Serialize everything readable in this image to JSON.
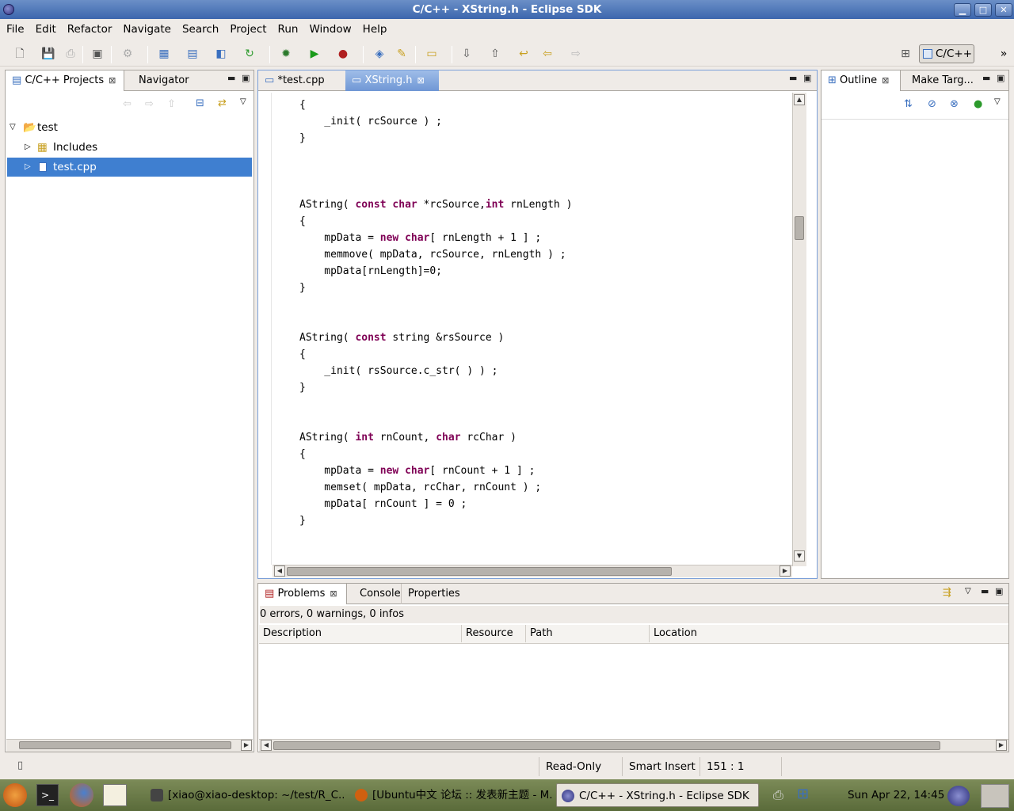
{
  "window": {
    "title": "C/C++ - XString.h - Eclipse SDK"
  },
  "menu": [
    "File",
    "Edit",
    "Refactor",
    "Navigate",
    "Search",
    "Project",
    "Run",
    "Window",
    "Help"
  ],
  "perspective": {
    "label": "C/C++",
    "more": "»"
  },
  "left_panel": {
    "tabs": [
      "C/C++ Projects",
      "Navigator"
    ],
    "tree": [
      {
        "label": "test",
        "level": 0,
        "expanded": true
      },
      {
        "label": "Includes",
        "level": 1,
        "expanded": false
      },
      {
        "label": "test.cpp",
        "level": 1,
        "expanded": false,
        "selected": true
      }
    ]
  },
  "editor": {
    "tabs": [
      "*test.cpp",
      "XString.h"
    ],
    "active_tab": "XString.h",
    "lines": [
      [
        {
          "t": "{"
        }
      ],
      [
        {
          "t": "    _init( rcSource ) ;"
        }
      ],
      [
        {
          "t": "}"
        }
      ],
      [
        {
          "t": ""
        }
      ],
      [
        {
          "t": ""
        }
      ],
      [
        {
          "t": ""
        }
      ],
      [
        {
          "t": "AString( "
        },
        {
          "t": "const",
          "k": 1
        },
        {
          "t": " "
        },
        {
          "t": "char",
          "k": 1
        },
        {
          "t": " *rcSource,"
        },
        {
          "t": "int",
          "k": 1
        },
        {
          "t": " rnLength )"
        }
      ],
      [
        {
          "t": "{"
        }
      ],
      [
        {
          "t": "    mpData = "
        },
        {
          "t": "new",
          "k": 1
        },
        {
          "t": " "
        },
        {
          "t": "char",
          "k": 1
        },
        {
          "t": "[ rnLength + 1 ] ;"
        }
      ],
      [
        {
          "t": "    memmove( mpData, rcSource, rnLength ) ;"
        }
      ],
      [
        {
          "t": "    mpData[rnLength]=0;"
        }
      ],
      [
        {
          "t": "}"
        }
      ],
      [
        {
          "t": ""
        }
      ],
      [
        {
          "t": ""
        }
      ],
      [
        {
          "t": "AString( "
        },
        {
          "t": "const",
          "k": 1
        },
        {
          "t": " string &rsSource )"
        }
      ],
      [
        {
          "t": "{"
        }
      ],
      [
        {
          "t": "    _init( rsSource.c_str( ) ) ;"
        }
      ],
      [
        {
          "t": "}"
        }
      ],
      [
        {
          "t": ""
        }
      ],
      [
        {
          "t": ""
        }
      ],
      [
        {
          "t": "AString( "
        },
        {
          "t": "int",
          "k": 1
        },
        {
          "t": " rnCount, "
        },
        {
          "t": "char",
          "k": 1
        },
        {
          "t": " rcChar )"
        }
      ],
      [
        {
          "t": "{"
        }
      ],
      [
        {
          "t": "    mpData = "
        },
        {
          "t": "new",
          "k": 1
        },
        {
          "t": " "
        },
        {
          "t": "char",
          "k": 1
        },
        {
          "t": "[ rnCount + 1 ] ;"
        }
      ],
      [
        {
          "t": "    memset( mpData, rcChar, rnCount ) ;"
        }
      ],
      [
        {
          "t": "    mpData[ rnCount ] = 0 ;"
        }
      ],
      [
        {
          "t": "}"
        }
      ]
    ]
  },
  "right_panel": {
    "tabs": [
      "Outline",
      "Make Targ..."
    ]
  },
  "bottom_panel": {
    "tabs": [
      "Problems",
      "Console",
      "Properties"
    ],
    "summary": "0 errors, 0 warnings, 0 infos",
    "columns": [
      "Description",
      "Resource",
      "Path",
      "Location"
    ]
  },
  "status": {
    "mode": "Read-Only",
    "insert": "Smart Insert",
    "position": "151 : 1"
  },
  "taskbar": {
    "items": [
      "[xiao@xiao-desktop: ~/test/R_C...",
      "[Ubuntu中文 论坛 :: 发表新主题 - M...",
      "C/C++ - XString.h - Eclipse SDK"
    ],
    "clock": "Sun Apr 22, 14:45"
  },
  "colors": {
    "keyword": "#7f0055",
    "selection": "#3f7fd0",
    "title_bar": "#3c66ad"
  }
}
